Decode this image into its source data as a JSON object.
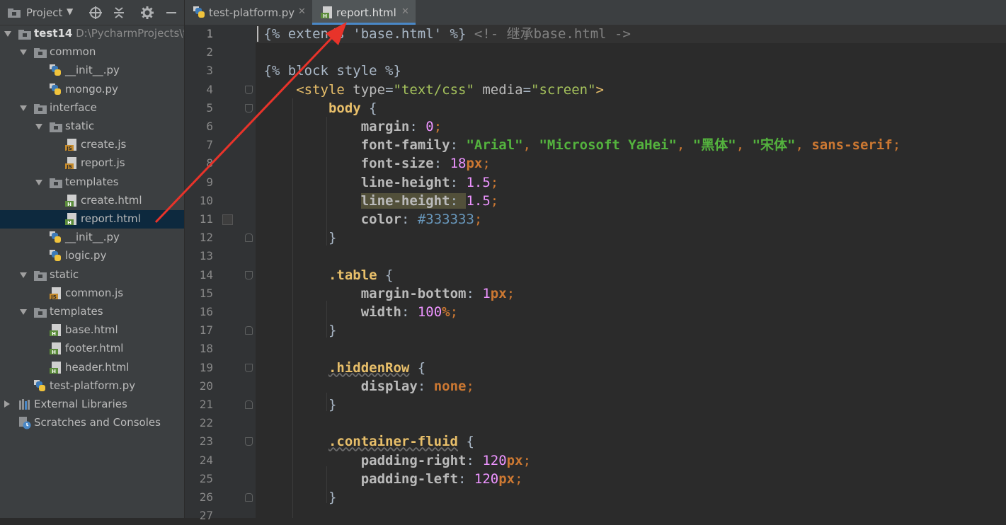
{
  "sidebar": {
    "title": "Project",
    "tree": [
      {
        "label": "test14",
        "path": "D:\\PycharmProjects\\te",
        "type": "folder",
        "state": "open",
        "level": 0
      },
      {
        "label": "common",
        "type": "folder",
        "state": "open",
        "level": 1
      },
      {
        "label": "__init__.py",
        "type": "py",
        "level": 2
      },
      {
        "label": "mongo.py",
        "type": "py",
        "level": 2
      },
      {
        "label": "interface",
        "type": "folder",
        "state": "open",
        "level": 1
      },
      {
        "label": "static",
        "type": "folder",
        "state": "open",
        "level": 2
      },
      {
        "label": "create.js",
        "type": "js",
        "level": 3
      },
      {
        "label": "report.js",
        "type": "js",
        "level": 3
      },
      {
        "label": "templates",
        "type": "folder",
        "state": "open",
        "level": 2
      },
      {
        "label": "create.html",
        "type": "html",
        "level": 3
      },
      {
        "label": "report.html",
        "type": "html",
        "level": 3,
        "selected": true
      },
      {
        "label": "__init__.py",
        "type": "py",
        "level": 2
      },
      {
        "label": "logic.py",
        "type": "py",
        "level": 2
      },
      {
        "label": "static",
        "type": "folder",
        "state": "open",
        "level": 1
      },
      {
        "label": "common.js",
        "type": "js",
        "level": 2
      },
      {
        "label": "templates",
        "type": "folder",
        "state": "open",
        "level": 1
      },
      {
        "label": "base.html",
        "type": "html",
        "level": 2
      },
      {
        "label": "footer.html",
        "type": "html",
        "level": 2
      },
      {
        "label": "header.html",
        "type": "html",
        "level": 2
      },
      {
        "label": "test-platform.py",
        "type": "py",
        "level": 1
      },
      {
        "label": "External Libraries",
        "type": "lib",
        "state": "closed",
        "level": 0
      },
      {
        "label": "Scratches and Consoles",
        "type": "scratch",
        "level": 0
      }
    ]
  },
  "tabs": [
    {
      "label": "test-platform.py",
      "icon": "python-file-icon",
      "active": false
    },
    {
      "label": "report.html",
      "icon": "html-file-icon",
      "active": true
    }
  ],
  "editor": {
    "current_line": 1,
    "line_numbers": [
      "1",
      "2",
      "3",
      "4",
      "5",
      "6",
      "7",
      "8",
      "9",
      "10",
      "11",
      "12",
      "13",
      "14",
      "15",
      "16",
      "17",
      "18",
      "19",
      "20",
      "21",
      "22",
      "23",
      "24",
      "25",
      "26",
      "27"
    ],
    "lines": [
      [
        [
          "tpl",
          "{% extends 'base.html' %} "
        ],
        [
          "cmt",
          "<!- 继承base.html ->"
        ]
      ],
      [],
      [
        [
          "tpl",
          "{% block style %}"
        ]
      ],
      [
        [
          "plain",
          "    "
        ],
        [
          "tag",
          "<style "
        ],
        [
          "attr",
          "type"
        ],
        [
          "plain",
          "="
        ],
        [
          "aval",
          "\"text/css\""
        ],
        [
          "plain",
          " "
        ],
        [
          "attr",
          "media"
        ],
        [
          "plain",
          "="
        ],
        [
          "aval",
          "\"screen\""
        ],
        [
          "tag",
          ">"
        ]
      ],
      [
        [
          "plain",
          "        "
        ],
        [
          "sel",
          "body"
        ],
        [
          "plain",
          " {"
        ]
      ],
      [
        [
          "plain",
          "            "
        ],
        [
          "prop",
          "margin"
        ],
        [
          "plain",
          ": "
        ],
        [
          "numpink",
          "0"
        ],
        [
          "punc",
          ";"
        ]
      ],
      [
        [
          "plain",
          "            "
        ],
        [
          "prop",
          "font-family"
        ],
        [
          "plain",
          ": "
        ],
        [
          "strv",
          "\"Arial\""
        ],
        [
          "punc",
          ", "
        ],
        [
          "strv",
          "\"Microsoft YaHei\""
        ],
        [
          "punc",
          ", "
        ],
        [
          "strv",
          "\"黑体\""
        ],
        [
          "punc",
          ", "
        ],
        [
          "strv",
          "\"宋体\""
        ],
        [
          "punc",
          ", "
        ],
        [
          "kw",
          "sans-serif"
        ],
        [
          "punc",
          ";"
        ]
      ],
      [
        [
          "plain",
          "            "
        ],
        [
          "prop",
          "font-size"
        ],
        [
          "plain",
          ": "
        ],
        [
          "numpink",
          "18"
        ],
        [
          "unit",
          "px"
        ],
        [
          "punc",
          ";"
        ]
      ],
      [
        [
          "plain",
          "            "
        ],
        [
          "prop",
          "line-height"
        ],
        [
          "plain",
          ": "
        ],
        [
          "numpink",
          "1.5"
        ],
        [
          "punc",
          ";"
        ]
      ],
      [
        [
          "plain",
          "            "
        ],
        [
          "prophl",
          "line-height"
        ],
        [
          "plainhl",
          ": "
        ],
        [
          "numpink",
          "1.5"
        ],
        [
          "punc",
          ";"
        ]
      ],
      [
        [
          "plain",
          "            "
        ],
        [
          "prop",
          "color"
        ],
        [
          "plain",
          ": "
        ],
        [
          "hex",
          "#333333"
        ],
        [
          "punc",
          ";"
        ]
      ],
      [
        [
          "plain",
          "        }"
        ]
      ],
      [],
      [
        [
          "plain",
          "        "
        ],
        [
          "cls",
          ".table"
        ],
        [
          "plain",
          " {"
        ]
      ],
      [
        [
          "plain",
          "            "
        ],
        [
          "prop",
          "margin-bottom"
        ],
        [
          "plain",
          ": "
        ],
        [
          "numpink",
          "1"
        ],
        [
          "unit",
          "px"
        ],
        [
          "punc",
          ";"
        ]
      ],
      [
        [
          "plain",
          "            "
        ],
        [
          "prop",
          "width"
        ],
        [
          "plain",
          ": "
        ],
        [
          "numpink",
          "100"
        ],
        [
          "unit",
          "%"
        ],
        [
          "punc",
          ";"
        ]
      ],
      [
        [
          "plain",
          "        }"
        ]
      ],
      [],
      [
        [
          "plain",
          "        "
        ],
        [
          "clswarn",
          ".hiddenRow"
        ],
        [
          "plain",
          " {"
        ]
      ],
      [
        [
          "plain",
          "            "
        ],
        [
          "prop",
          "display"
        ],
        [
          "plain",
          ": "
        ],
        [
          "kw",
          "none"
        ],
        [
          "punc",
          ";"
        ]
      ],
      [
        [
          "plain",
          "        }"
        ]
      ],
      [],
      [
        [
          "plain",
          "        "
        ],
        [
          "clswarn",
          ".container-fluid"
        ],
        [
          "plain",
          " {"
        ]
      ],
      [
        [
          "plain",
          "            "
        ],
        [
          "prop",
          "padding-right"
        ],
        [
          "plain",
          ": "
        ],
        [
          "numpink",
          "120"
        ],
        [
          "unit",
          "px"
        ],
        [
          "punc",
          ";"
        ]
      ],
      [
        [
          "plain",
          "            "
        ],
        [
          "prop",
          "padding-left"
        ],
        [
          "plain",
          ": "
        ],
        [
          "numpink",
          "120"
        ],
        [
          "unit",
          "px"
        ],
        [
          "punc",
          ";"
        ]
      ],
      [
        [
          "plain",
          "        }"
        ]
      ],
      []
    ]
  }
}
